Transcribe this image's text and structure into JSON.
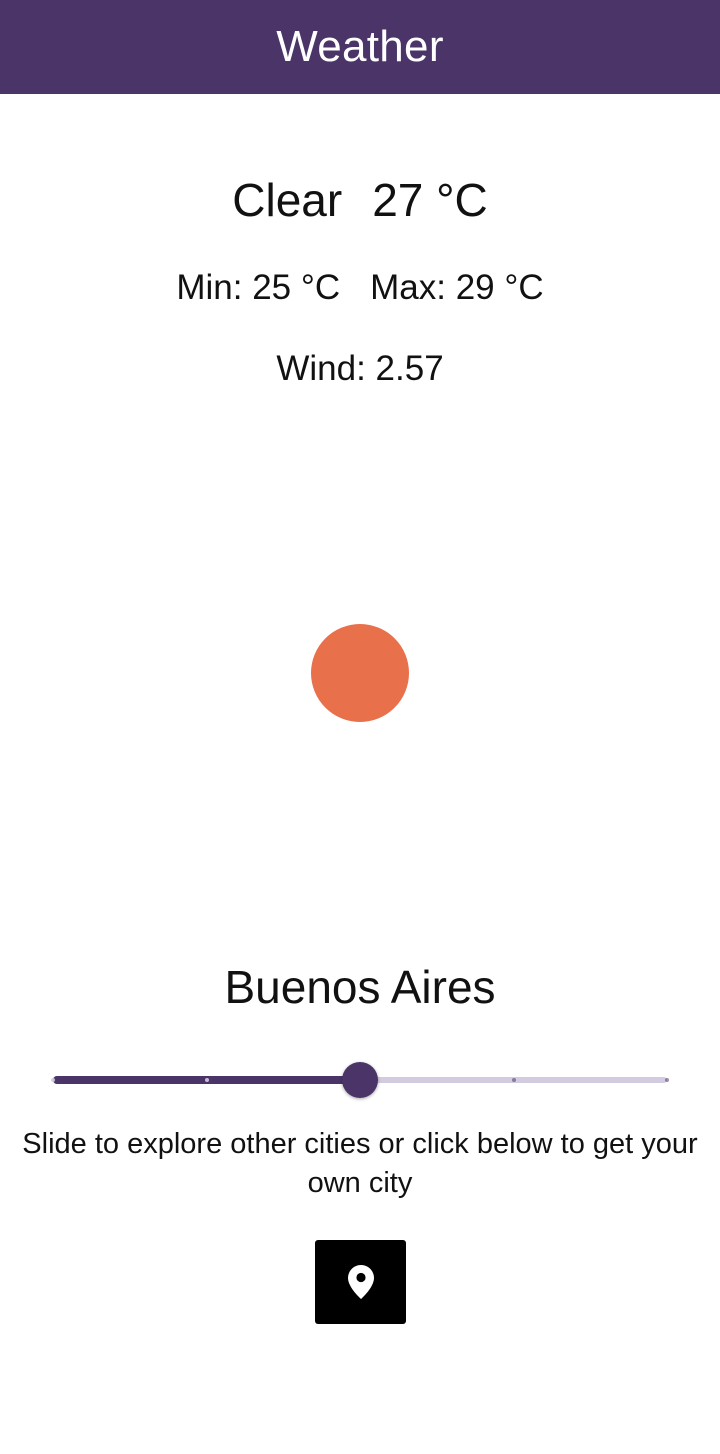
{
  "app_bar": {
    "title": "Weather",
    "background": "#4a3468"
  },
  "weather": {
    "condition": "Clear",
    "temperature": "27 °C",
    "min": "Min: 25 °C",
    "max": "Max: 29 °C",
    "wind": "Wind: 2.57",
    "icon": "sun-icon",
    "icon_color": "#e8704a"
  },
  "city": {
    "name": "Buenos Aires"
  },
  "slider": {
    "stops": 5,
    "selected_index": 2,
    "active_color": "#4a3468",
    "inactive_color": "#d3cce0"
  },
  "hint": {
    "text": "Slide to explore other cities or click below to get your own city"
  },
  "locate_button": {
    "icon": "location-pin-icon",
    "background": "#000000",
    "icon_color": "#ffffff"
  }
}
